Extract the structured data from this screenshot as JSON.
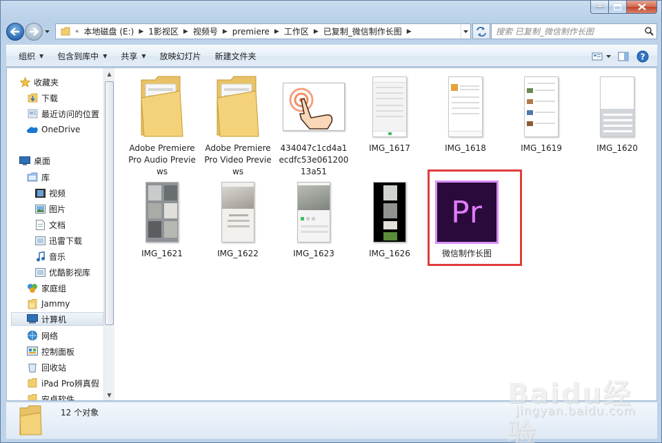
{
  "window": {
    "caption_buttons": [
      "minimize-icon",
      "maximize-icon",
      "close-icon"
    ]
  },
  "address_bar": {
    "overflow_chevron": "«",
    "crumbs": [
      "本地磁盘 (E:)",
      "1影视区",
      "视频号",
      "premiere",
      "工作区",
      "已复制_微信制作长图"
    ]
  },
  "search": {
    "placeholder": "搜索 已复制_微信制作长图"
  },
  "toolbar": {
    "organize": "组织",
    "include_in_library": "包含到库中",
    "share": "共享",
    "slideshow": "放映幻灯片",
    "new_folder": "新建文件夹"
  },
  "sidebar": {
    "favorites": {
      "label": "收藏夹",
      "items": [
        "下载",
        "最近访问的位置",
        "OneDrive"
      ]
    },
    "desktop": "桌面",
    "libraries": {
      "label": "库",
      "items": [
        "视频",
        "图片",
        "文档",
        "迅雷下载",
        "音乐",
        "优酷影视库"
      ]
    },
    "homegroup": "家庭组",
    "user": "Jammy",
    "computer": "计算机",
    "network": "网络",
    "control_panel": "控制面板",
    "recycle_bin": "回收站",
    "extra": [
      "iPad Pro辨真假",
      "安卓软件"
    ]
  },
  "files": [
    {
      "name": "Adobe Premiere Pro Audio Previews",
      "kind": "folder"
    },
    {
      "name": "Adobe Premiere Pro Video Previews",
      "kind": "folder"
    },
    {
      "name": "434047c1cd4a1ecdfc53e06120013a51",
      "kind": "image-touch"
    },
    {
      "name": "IMG_1617",
      "kind": "image-phone"
    },
    {
      "name": "IMG_1618",
      "kind": "image-phone"
    },
    {
      "name": "IMG_1619",
      "kind": "image-phone"
    },
    {
      "name": "IMG_1620",
      "kind": "image-phone"
    },
    {
      "name": "IMG_1621",
      "kind": "image-photo"
    },
    {
      "name": "IMG_1622",
      "kind": "image-photo"
    },
    {
      "name": "IMG_1623",
      "kind": "image-photo"
    },
    {
      "name": "IMG_1626",
      "kind": "image-photo"
    },
    {
      "name": "微信制作长图",
      "kind": "premiere-project",
      "icon_text": "Pr",
      "selected": true
    }
  ],
  "status": {
    "count": "12 个对象"
  },
  "watermark": {
    "brand": "Baidu经验",
    "sub": "jingyan.baidu.com"
  },
  "colors": {
    "premiere_bg": "#2a0a3a",
    "premiere_accent": "#e07bff",
    "highlight": "#e03c3c",
    "folder": "#f3d27a"
  }
}
